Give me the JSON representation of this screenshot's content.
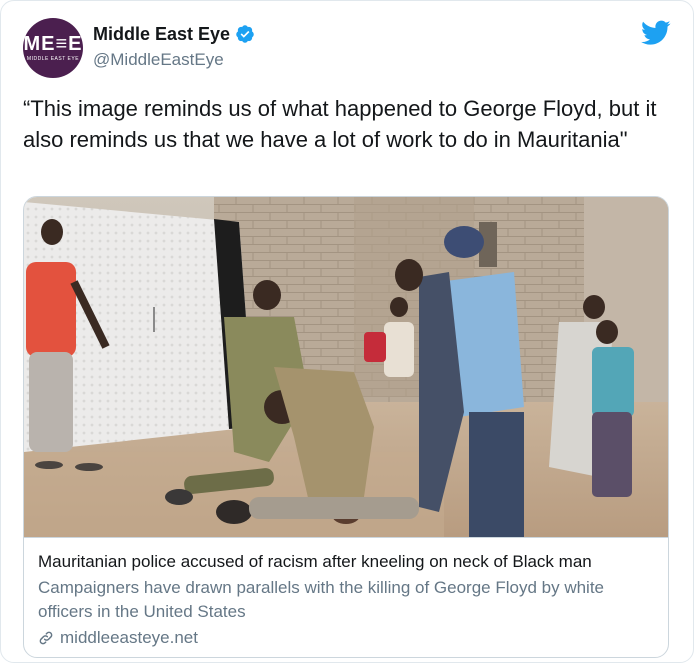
{
  "account": {
    "avatar_text": "ME≡E",
    "avatar_subtext": "MIDDLE EAST EYE",
    "display_name": "Middle East Eye",
    "handle": "@MiddleEastEye",
    "verified": true
  },
  "tweet": {
    "text": "“This image reminds us of what happened to George Floyd, but it also reminds us that we have a lot of work to do in Mauritania\""
  },
  "card": {
    "image_icon": "photo-people-street",
    "title": "Mauritanian police accused of racism after kneeling on neck of Black man",
    "description": "Campaigners have drawn parallels with the killing of George Floyd by white officers in the United States",
    "domain": "middleeasteye.net"
  },
  "colors": {
    "twitter_blue": "#1da1f2",
    "avatar_bg": "#4b1f4f",
    "text": "#14171a",
    "secondary": "#657786",
    "border": "#ccd6dd"
  }
}
